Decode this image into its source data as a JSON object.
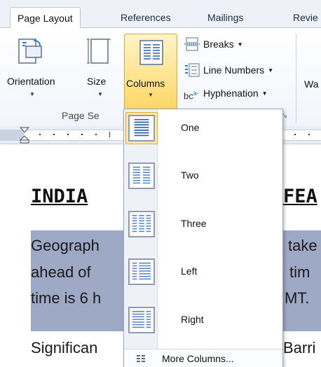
{
  "tabs": [
    {
      "label": "Page Layout",
      "active": true
    },
    {
      "label": "References",
      "active": false
    },
    {
      "label": "Mailings",
      "active": false
    },
    {
      "label": "Revie",
      "active": false
    }
  ],
  "ribbon": {
    "orientation_label": "Orientation",
    "size_label": "Size",
    "columns_label": "Columns",
    "breaks_label": "Breaks",
    "line_numbers_label": "Line Numbers",
    "hyphenation_label": "Hyphenation",
    "hyphenation_icon_text": "bc",
    "group_label": "Page Se",
    "next_group_label": "Wa"
  },
  "columns_menu": {
    "items": [
      {
        "label": "One",
        "selected": true
      },
      {
        "label": "Two",
        "selected": false
      },
      {
        "label": "Three",
        "selected": false
      },
      {
        "label": "Left",
        "selected": false
      },
      {
        "label": "Right",
        "selected": false
      }
    ],
    "more_label": "More Columns..."
  },
  "document": {
    "heading_left": "INDIA",
    "heading_right": "FEA",
    "lines": [
      {
        "left": "Geograph",
        "right": "take"
      },
      {
        "left": "ahead of",
        "right": "tim"
      },
      {
        "left": "time is 6 h",
        "right": "MT."
      }
    ],
    "bottom_left": "Significan",
    "bottom_right": "Barri"
  },
  "colors": {
    "highlight": "#9ea9c5",
    "selected_fill": "#ffd766",
    "tab_strip": "#eef2f8"
  }
}
